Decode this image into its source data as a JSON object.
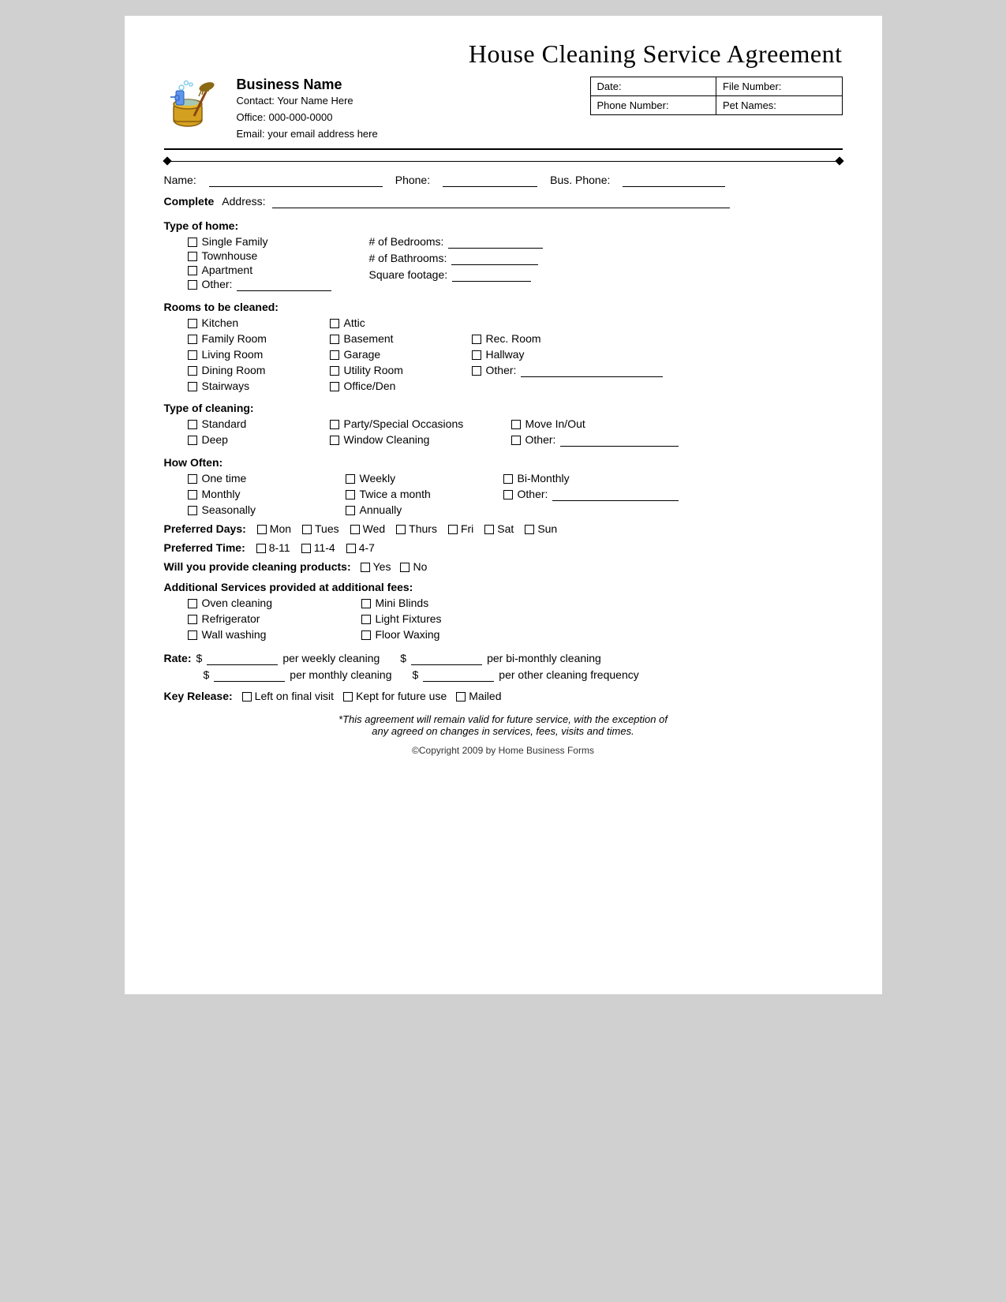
{
  "title": "House Cleaning Service Agreement",
  "business": {
    "name": "Business Name",
    "contact_label": "Contact:",
    "contact_value": "Your Name Here",
    "office_label": "Office:",
    "office_value": "000-000-0000",
    "email_label": "Email:",
    "email_value": "your email address here"
  },
  "header_fields": {
    "date_label": "Date:",
    "file_label": "File Number:",
    "phone_label": "Phone Number:",
    "pet_label": "Pet Names:"
  },
  "name_line": {
    "name_label": "Name:",
    "phone_label": "Phone:",
    "bus_phone_label": "Bus. Phone:"
  },
  "address_line": {
    "label": "Complete Address:"
  },
  "type_of_home": {
    "title": "Type of home:",
    "options": [
      "Single Family",
      "Townhouse",
      "Apartment",
      "Other:"
    ],
    "fields": [
      {
        "label": "# of Bedrooms:",
        "ul_width": 130
      },
      {
        "label": "# of Bathrooms:",
        "ul_width": 120
      },
      {
        "label": "Square footage:",
        "ul_width": 110
      }
    ]
  },
  "rooms": {
    "title": "Rooms to be cleaned:",
    "col1": [
      "Kitchen",
      "Family Room",
      "Living Room",
      "Dining Room",
      "Stairways"
    ],
    "col2": [
      "Attic",
      "Basement",
      "Garage",
      "Utility Room",
      "Office/Den"
    ],
    "col3": [
      "",
      "Rec. Room",
      "Hallway",
      "Other:"
    ]
  },
  "type_of_cleaning": {
    "title": "Type of cleaning:",
    "col1": [
      "Standard",
      "Deep"
    ],
    "col2": [
      "Party/Special Occasions",
      "Window Cleaning"
    ],
    "col3": [
      "Move In/Out",
      "Other:"
    ]
  },
  "how_often": {
    "title": "How Often:",
    "col1": [
      "One time",
      "Monthly",
      "Seasonally"
    ],
    "col2": [
      "Weekly",
      "Twice a month",
      "Annually"
    ],
    "col3": [
      "Bi-Monthly",
      "Other:"
    ]
  },
  "preferred_days": {
    "label": "Preferred Days:",
    "days": [
      "Mon",
      "Tues",
      "Wed",
      "Thurs",
      "Fri",
      "Sat",
      "Sun"
    ]
  },
  "preferred_time": {
    "label": "Preferred Time:",
    "times": [
      "8-11",
      "11-4",
      "4-7"
    ]
  },
  "products": {
    "label": "Will you provide cleaning products:",
    "yes": "Yes",
    "no": "No"
  },
  "additional_services": {
    "title": "Additional Services provided at additional fees:",
    "col1": [
      "Oven cleaning",
      "Refrigerator",
      "Wall washing"
    ],
    "col2": [
      "Mini Blinds",
      "Light Fixtures",
      "Floor Waxing"
    ]
  },
  "rates": {
    "label": "Rate:",
    "dollar": "$",
    "per_weekly": "per weekly cleaning",
    "per_bimonthly": "per bi-monthly cleaning",
    "per_monthly": "per monthly cleaning",
    "per_other": "per other cleaning frequency"
  },
  "key_release": {
    "label": "Key Release:",
    "options": [
      "Left on final visit",
      "Kept for future use",
      "Mailed"
    ]
  },
  "footer": {
    "italic_text": "*This agreement will remain valid for future service, with the exception of",
    "italic_text2": "any agreed on changes in services, fees, visits and times.",
    "copyright": "©Copyright 2009 by Home Business Forms"
  }
}
